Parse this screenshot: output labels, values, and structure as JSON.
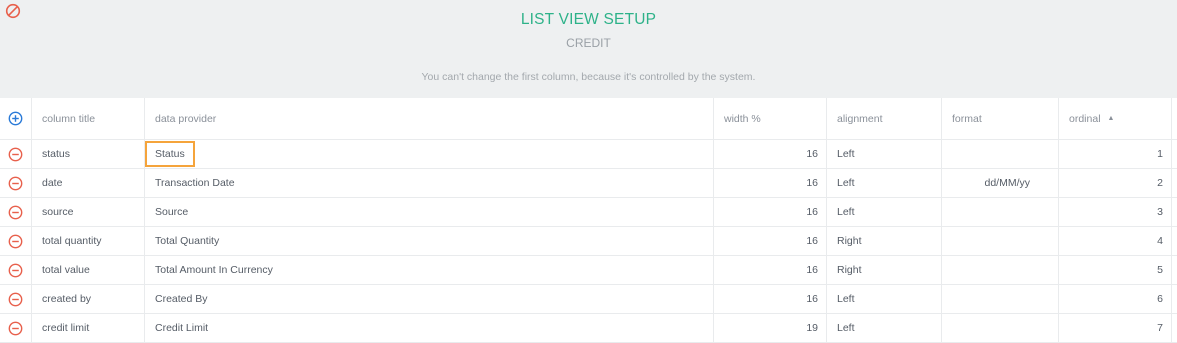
{
  "header": {
    "title": "LIST VIEW SETUP",
    "subtitle": "CREDIT",
    "note": "You can't change the first column, because it's controlled by the system."
  },
  "columns": {
    "title": "column title",
    "provider": "data provider",
    "width": "width %",
    "alignment": "alignment",
    "format": "format",
    "ordinal": "ordinal",
    "ordinal_sort_icon": "sort-up-icon"
  },
  "rows": [
    {
      "title": "status",
      "provider": "Status",
      "width": "16",
      "alignment": "Left",
      "format": "",
      "ordinal": "1"
    },
    {
      "title": "date",
      "provider": "Transaction Date",
      "width": "16",
      "alignment": "Left",
      "format": "dd/MM/yy",
      "ordinal": "2"
    },
    {
      "title": "source",
      "provider": "Source",
      "width": "16",
      "alignment": "Left",
      "format": "",
      "ordinal": "3"
    },
    {
      "title": "total quantity",
      "provider": "Total Quantity",
      "width": "16",
      "alignment": "Right",
      "format": "",
      "ordinal": "4"
    },
    {
      "title": "total value",
      "provider": "Total Amount In Currency",
      "width": "16",
      "alignment": "Right",
      "format": "",
      "ordinal": "5"
    },
    {
      "title": "created by",
      "provider": "Created By",
      "width": "16",
      "alignment": "Left",
      "format": "",
      "ordinal": "6"
    },
    {
      "title": "credit limit",
      "provider": "Credit Limit",
      "width": "19",
      "alignment": "Left",
      "format": "",
      "ordinal": "7"
    }
  ],
  "colors": {
    "title": "#2db289",
    "remove": "#e8604c",
    "add": "#2a7ad8",
    "highlight": "#f5a43b"
  }
}
